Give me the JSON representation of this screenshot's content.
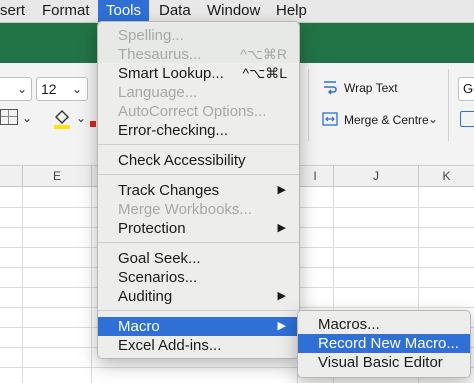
{
  "menubar": {
    "items": [
      "sert",
      "Format",
      "Tools",
      "Data",
      "Window",
      "Help"
    ],
    "active": "Tools"
  },
  "ribbon": {
    "font_size": "12",
    "wrap_text": "Wrap Text",
    "merge_centre": "Merge & Centre",
    "number_format_partial": "Ge"
  },
  "grid": {
    "columns": [
      "E",
      "I",
      "J",
      "K"
    ]
  },
  "tools_menu": {
    "spelling": "Spelling...",
    "thesaurus": "Thesaurus...",
    "thesaurus_shortcut": "^⌥⌘R",
    "smart_lookup": "Smart Lookup...",
    "smart_lookup_shortcut": "^⌥⌘L",
    "language": "Language...",
    "autocorrect": "AutoCorrect Options...",
    "error_checking": "Error-checking...",
    "check_accessibility": "Check Accessibility",
    "track_changes": "Track Changes",
    "merge_workbooks": "Merge Workbooks...",
    "protection": "Protection",
    "goal_seek": "Goal Seek...",
    "scenarios": "Scenarios...",
    "auditing": "Auditing",
    "macro": "Macro",
    "excel_addins": "Excel Add-ins..."
  },
  "macro_submenu": {
    "macros": "Macros...",
    "record_new_macro": "Record New Macro...",
    "visual_basic_editor": "Visual Basic Editor"
  },
  "colors": {
    "excel_green": "#227446",
    "highlight_blue": "#2f6fd6",
    "highlighter_yellow": "#ffe600",
    "font_red": "#d9261c"
  }
}
